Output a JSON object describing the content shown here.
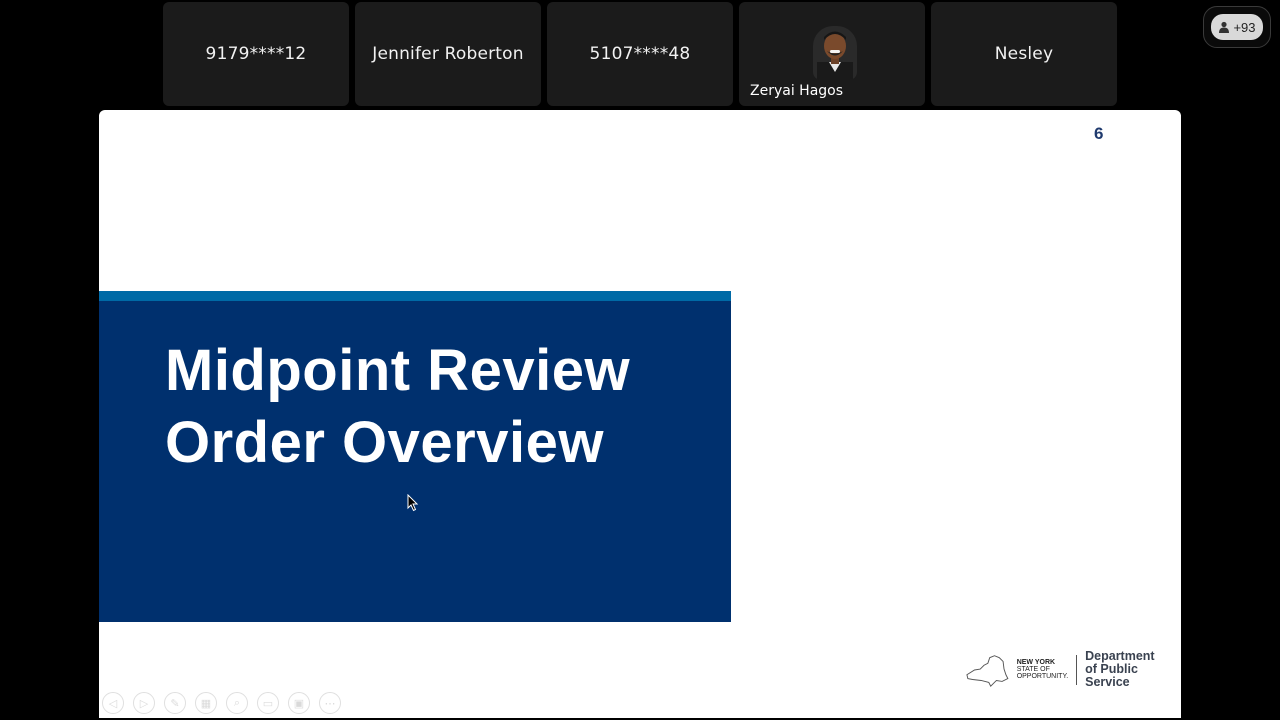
{
  "participants": [
    {
      "name": "9179****12",
      "video": false
    },
    {
      "name": "Jennifer Roberton",
      "video": false
    },
    {
      "name": "5107****48",
      "video": false
    },
    {
      "name": "Zeryai Hagos",
      "video": true
    },
    {
      "name": "Nesley",
      "video": false
    }
  ],
  "overflow_count": "+93",
  "icons": {
    "overflow": "person-icon",
    "cursor": "mouse-pointer-icon"
  },
  "slide": {
    "number": "6",
    "title_line1": "Midpoint Review",
    "title_line2": "Order Overview",
    "logo": {
      "ny_line1": "NEW YORK",
      "ny_line2": "STATE OF",
      "ny_line3": "OPPORTUNITY.",
      "dept_line1": "Department",
      "dept_line2": "of Public Service"
    }
  },
  "colors": {
    "band": "#00306e",
    "stripe": "#006aa6",
    "background": "#000000",
    "tile": "#1b1b1b"
  }
}
